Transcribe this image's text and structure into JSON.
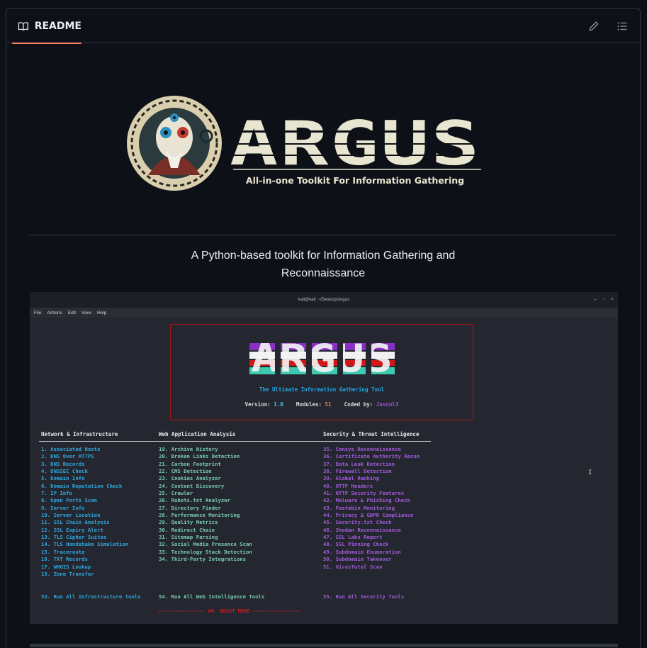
{
  "header": {
    "tab_label": "README",
    "edit_icon": "pencil-icon",
    "outline_icon": "list-icon"
  },
  "logo": {
    "wordmark": "ARGUS",
    "subtitle": "All-in-one Toolkit For Information Gathering"
  },
  "tagline": "A Python-based toolkit for Information Gathering and Reconnaissance",
  "terminal": {
    "window_title": "kali@kali: ~/Desktop/Argus",
    "menu": [
      "File",
      "Actions",
      "Edit",
      "View",
      "Help"
    ],
    "banner_art": "ARGUS",
    "banner_subtitle": "The Ultimate Information Gathering Tool",
    "version_label": "Version:",
    "version_value": "1.0",
    "modules_label": "Modules:",
    "modules_value": "51",
    "coded_label": "Coded by:",
    "coded_value": "Jasonl3",
    "columns": {
      "network": {
        "title": "Network & Infrastructure",
        "items": [
          "1. Associated Hosts",
          "2. DNS Over HTTPS",
          "3. DNS Records",
          "4. DNSSEC Check",
          "5. Domain Info",
          "6. Domain Reputation Check",
          "7. IP Info",
          "8. Open Ports Scan",
          "9. Server Info",
          "10. Server Location",
          "11. SSL Chain Analysis",
          "12. SSL Expiry Alert",
          "13. TLS Cipher Suites",
          "14. TLS Handshake Simulation",
          "15. Traceroute",
          "16. TXT Records",
          "17. WHOIS Lookup",
          "18. Zone Transfer"
        ]
      },
      "web": {
        "title": "Web Application Analysis",
        "items": [
          "19. Archive History",
          "20. Broken Links Detection",
          "21. Carbon Footprint",
          "22. CMS Detection",
          "23. Cookies Analyzer",
          "24. Content Discovery",
          "25. Crawler",
          "26. Robots.txt Analyzer",
          "27. Directory Finder",
          "28. Performance Monitoring",
          "29. Quality Metrics",
          "30. Redirect Chain",
          "31. Sitemap Parsing",
          "32. Social Media Presence Scan",
          "33. Technology Stack Detection",
          "34. Third-Party Integrations"
        ]
      },
      "security": {
        "title": "Security & Threat Intelligence",
        "items": [
          "35. Censys Reconnaissance",
          "36. Certificate Authority Recon",
          "37. Data Leak Detection",
          "38. Firewall Detection",
          "39. Global Ranking",
          "40. HTTP Headers",
          "41. HTTP Security Features",
          "42. Malware & Phishing Check",
          "43. Pastebin Monitoring",
          "44. Privacy & GDPR Compliance",
          "45. Security.txt Check",
          "46. Shodan Reconnaissance",
          "47. SSL Labs Report",
          "48. SSL Pinning Check",
          "49. Subdomain Enumeration",
          "50. Subdomain Takeover",
          "51. VirusTotal Scan"
        ]
      }
    },
    "run_all": {
      "infra": "53. Run All Infrastructure Tools",
      "web": "54. Run All Web Intelligence Tools",
      "security": "55. Run All Security Tools"
    },
    "beast_mode": "---------------- 00. BEAST MODE ----------------"
  },
  "colors": {
    "accent_tab": "#f78166",
    "infra_blue": "#2fa7e0",
    "web_teal": "#79c9b6",
    "sec_purple": "#a05ad8",
    "beast_red": "#c81e1e"
  }
}
